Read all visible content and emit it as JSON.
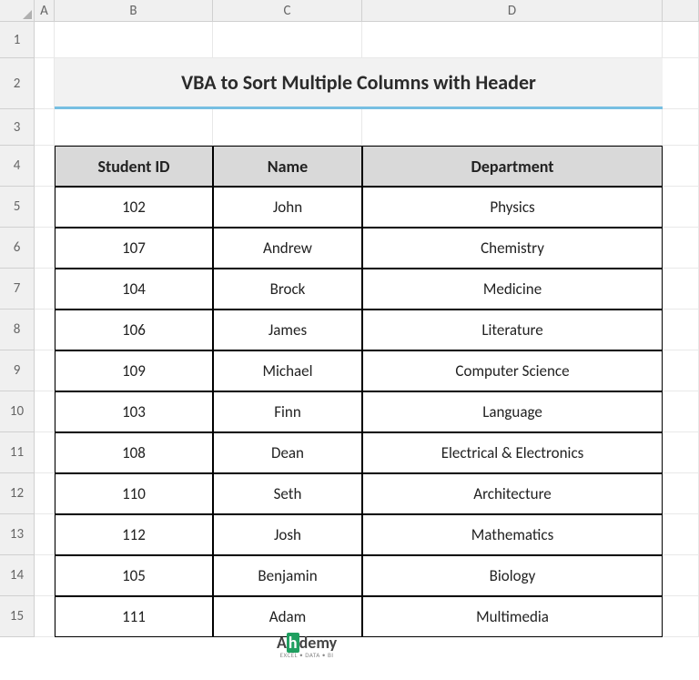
{
  "columns": [
    "A",
    "B",
    "C",
    "D"
  ],
  "row_numbers": [
    "1",
    "2",
    "3",
    "4",
    "5",
    "6",
    "7",
    "8",
    "9",
    "10",
    "11",
    "12",
    "13",
    "14",
    "15"
  ],
  "title": "VBA to Sort Multiple Columns with Header",
  "headers": {
    "student_id": "Student ID",
    "name": "Name",
    "department": "Department"
  },
  "rows": [
    {
      "id": "102",
      "name": "John",
      "dept": "Physics"
    },
    {
      "id": "107",
      "name": "Andrew",
      "dept": "Chemistry"
    },
    {
      "id": "104",
      "name": "Brock",
      "dept": "Medicine"
    },
    {
      "id": "106",
      "name": "James",
      "dept": "Literature"
    },
    {
      "id": "109",
      "name": "Michael",
      "dept": "Computer Science"
    },
    {
      "id": "103",
      "name": "Finn",
      "dept": "Language"
    },
    {
      "id": "108",
      "name": "Dean",
      "dept": "Electrical & Electronics"
    },
    {
      "id": "110",
      "name": "Seth",
      "dept": "Architecture"
    },
    {
      "id": "112",
      "name": "Josh",
      "dept": "Mathematics"
    },
    {
      "id": "105",
      "name": "Benjamin",
      "dept": "Biology"
    },
    {
      "id": "111",
      "name": "Adam",
      "dept": "Multimedia"
    }
  ],
  "watermark": {
    "brand_pre": "A",
    "brand_mid": "h",
    "brand_post": "demy",
    "tagline": "EXCEL • DATA • BI"
  },
  "chart_data": {
    "type": "table",
    "title": "VBA to Sort Multiple Columns with Header",
    "columns": [
      "Student ID",
      "Name",
      "Department"
    ],
    "data": [
      [
        102,
        "John",
        "Physics"
      ],
      [
        107,
        "Andrew",
        "Chemistry"
      ],
      [
        104,
        "Brock",
        "Medicine"
      ],
      [
        106,
        "James",
        "Literature"
      ],
      [
        109,
        "Michael",
        "Computer Science"
      ],
      [
        103,
        "Finn",
        "Language"
      ],
      [
        108,
        "Dean",
        "Electrical & Electronics"
      ],
      [
        110,
        "Seth",
        "Architecture"
      ],
      [
        112,
        "Josh",
        "Mathematics"
      ],
      [
        105,
        "Benjamin",
        "Biology"
      ],
      [
        111,
        "Adam",
        "Multimedia"
      ]
    ]
  }
}
